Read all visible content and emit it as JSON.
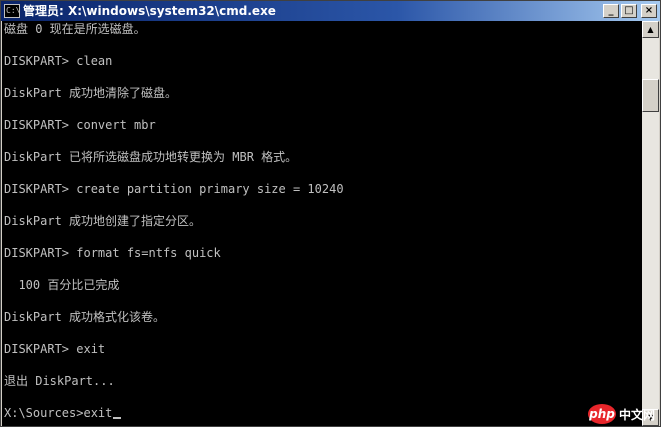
{
  "window": {
    "title": "管理员: X:\\windows\\system32\\cmd.exe",
    "icon_label": "C:\\",
    "minimize_icon": "minimize-icon",
    "maximize_icon": "maximize-icon",
    "close_icon": "close-icon",
    "minimize_glyph": "_",
    "maximize_glyph": "□",
    "close_glyph": "×"
  },
  "console": {
    "foreground": "#c0c0c0",
    "background": "#000000",
    "lines": [
      "磁盘 0 现在是所选磁盘。",
      "",
      "DISKPART> clean",
      "",
      "DiskPart 成功地清除了磁盘。",
      "",
      "DISKPART> convert mbr",
      "",
      "DiskPart 已将所选磁盘成功地转更换为 MBR 格式。",
      "",
      "DISKPART> create partition primary size = 10240",
      "",
      "DiskPart 成功地创建了指定分区。",
      "",
      "DISKPART> format fs=ntfs quick",
      "",
      "  100 百分比已完成",
      "",
      "DiskPart 成功格式化该卷。",
      "",
      "DISKPART> exit",
      "",
      "退出 DiskPart...",
      "",
      "X:\\Sources>exit"
    ]
  },
  "scrollbar": {
    "up_glyph": "▲",
    "down_glyph": "▼",
    "thumb_position": 0.11,
    "thumb_size": 0.09
  },
  "watermark": {
    "logo": "php",
    "text": "中文网"
  }
}
